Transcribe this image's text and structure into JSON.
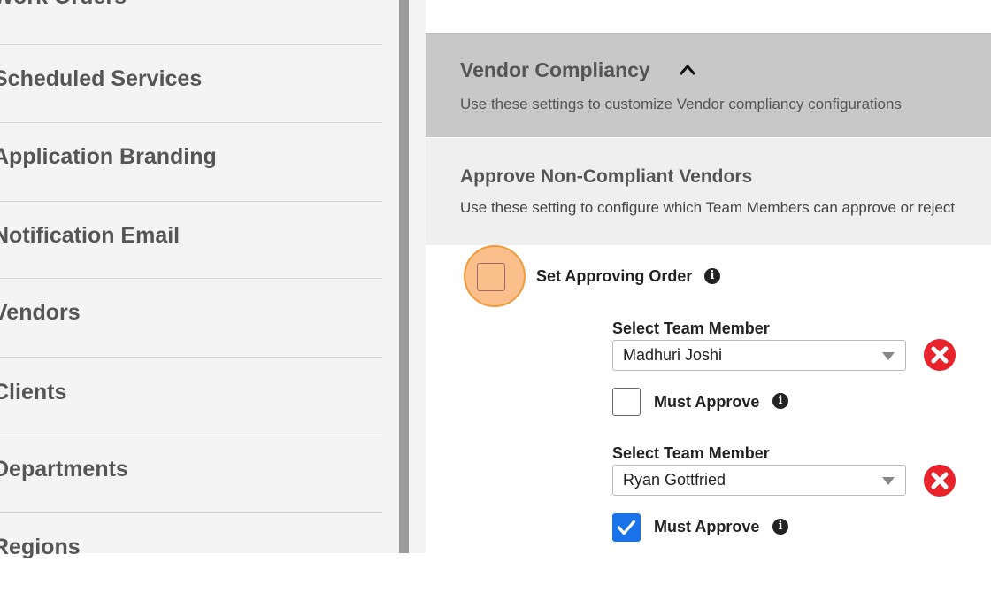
{
  "sidebar": {
    "items": [
      {
        "label": "Work Orders"
      },
      {
        "label": "Scheduled Services"
      },
      {
        "label": "Application Branding"
      },
      {
        "label": "Notification Email"
      },
      {
        "label": "Vendors"
      },
      {
        "label": "Clients"
      },
      {
        "label": "Departments"
      },
      {
        "label": "Regions"
      }
    ]
  },
  "section": {
    "title": "Vendor Compliancy",
    "description": "Use these settings to customize Vendor compliancy configurations",
    "toggle_icon": "chevron-up-icon"
  },
  "subsection": {
    "title": "Approve Non-Compliant Vendors",
    "description": "Use these setting to configure which Team Members can approve or reject"
  },
  "approving_order": {
    "label": "Set Approving Order",
    "checked": false
  },
  "approvers": [
    {
      "field_label": "Select Team Member",
      "value": "Madhuri Joshi",
      "must_approve_label": "Must Approve",
      "must_approve": false
    },
    {
      "field_label": "Select Team Member",
      "value": "Ryan Gottfried",
      "must_approve_label": "Must Approve",
      "must_approve": true
    }
  ],
  "colors": {
    "accent": "#1a73e8",
    "remove": "#e8232b",
    "highlight": "#fbbf8c"
  }
}
